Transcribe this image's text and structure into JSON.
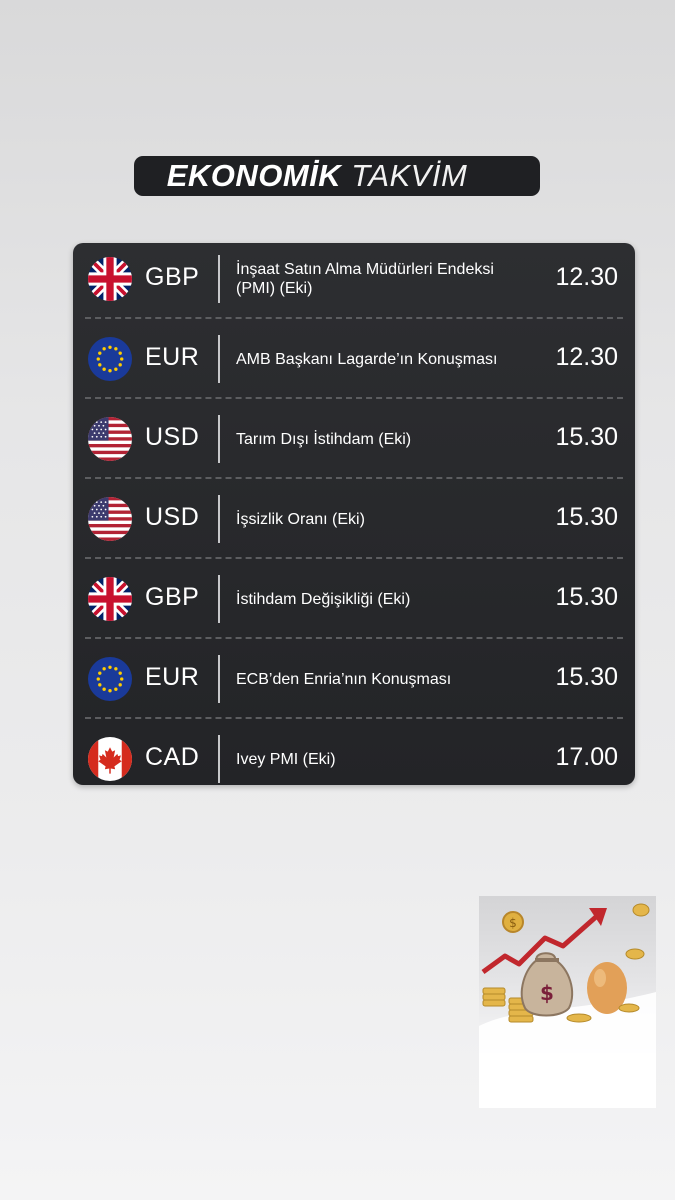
{
  "header": {
    "title_bold": "EKONOMİK",
    "title_light": "TAKVİM"
  },
  "events": [
    {
      "flag": "uk-flag-icon",
      "currency": "GBP",
      "event": "İnşaat Satın Alma Müdürleri Endeksi (PMI) (Eki)",
      "time": "12.30"
    },
    {
      "flag": "eu-flag-icon",
      "currency": "EUR",
      "event": "AMB Başkanı Lagarde’ın Konuşması",
      "time": "12.30"
    },
    {
      "flag": "us-flag-icon",
      "currency": "USD",
      "event": "Tarım Dışı İstihdam (Eki)",
      "time": "15.30"
    },
    {
      "flag": "us-flag-icon",
      "currency": "USD",
      "event": "İşsizlik Oranı (Eki)",
      "time": "15.30"
    },
    {
      "flag": "uk-flag-icon",
      "currency": "GBP",
      "event": "İstihdam Değişikliği (Eki)",
      "time": "15.30"
    },
    {
      "flag": "eu-flag-icon",
      "currency": "EUR",
      "event": "ECB’den Enria’nın Konuşması",
      "time": "15.30"
    },
    {
      "flag": "canada-flag-icon",
      "currency": "CAD",
      "event": "Ivey PMI (Eki)",
      "time": "17.00"
    }
  ],
  "colors": {
    "card_bg": "#2a2b2e",
    "title_bg": "#1f2023",
    "text": "#ffffff",
    "uk_blue": "#012169",
    "uk_red": "#c8102e",
    "eu_blue": "#1a3a9a",
    "eu_star": "#ffcc00",
    "us_red": "#b22234",
    "us_blue": "#3c3b6e",
    "ca_red": "#d52b1e"
  },
  "decoration": {
    "icon": "money-growth-illustration-icon"
  }
}
